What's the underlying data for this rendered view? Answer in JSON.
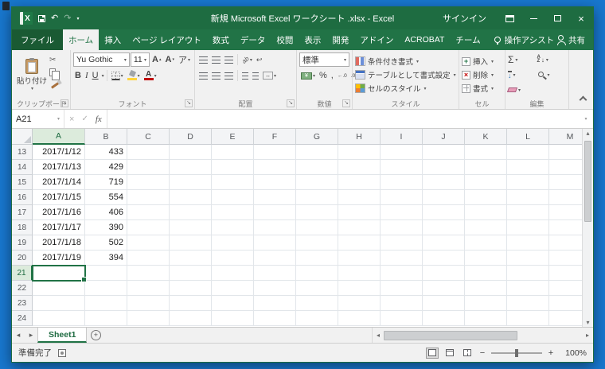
{
  "colors": {
    "accent": "#217346",
    "titlebar": "#1E6C41",
    "desktop": "#1877CE"
  },
  "titlebar": {
    "title": "新規 Microsoft Excel ワークシート .xlsx - Excel",
    "sign_in": "サインイン"
  },
  "ribbon": {
    "file_tab": "ファイル",
    "active_tab": "ホーム",
    "tabs": [
      "ホーム",
      "挿入",
      "ページ レイアウト",
      "数式",
      "データ",
      "校閲",
      "表示",
      "開発",
      "アドイン",
      "ACROBAT",
      "チーム"
    ],
    "tell_me": "操作アシスト",
    "share": "共有",
    "groups": {
      "clipboard": {
        "label": "クリップボード",
        "paste": "貼り付け"
      },
      "font": {
        "label": "フォント",
        "name": "Yu Gothic",
        "size": "11"
      },
      "alignment": {
        "label": "配置"
      },
      "number": {
        "label": "数値",
        "format": "標準"
      },
      "styles": {
        "label": "スタイル",
        "items": [
          "条件付き書式",
          "テーブルとして書式設定",
          "セルのスタイル"
        ]
      },
      "cells": {
        "label": "セル",
        "items": [
          "挿入",
          "削除",
          "書式"
        ]
      },
      "editing": {
        "label": "編集"
      }
    }
  },
  "formula_bar": {
    "name_box": "A21",
    "cancel": "×",
    "enter": "✓",
    "fx": "fx",
    "value": ""
  },
  "sheet": {
    "columns": [
      "A",
      "B",
      "C",
      "D",
      "E",
      "F",
      "G",
      "H",
      "I",
      "J",
      "K",
      "L",
      "M"
    ],
    "rows": [
      {
        "n": "13",
        "cells": {
          "A": "2017/1/12",
          "B": "433"
        }
      },
      {
        "n": "14",
        "cells": {
          "A": "2017/1/13",
          "B": "429"
        }
      },
      {
        "n": "15",
        "cells": {
          "A": "2017/1/14",
          "B": "719"
        }
      },
      {
        "n": "16",
        "cells": {
          "A": "2017/1/15",
          "B": "554"
        }
      },
      {
        "n": "17",
        "cells": {
          "A": "2017/1/16",
          "B": "406"
        }
      },
      {
        "n": "18",
        "cells": {
          "A": "2017/1/17",
          "B": "390"
        }
      },
      {
        "n": "19",
        "cells": {
          "A": "2017/1/18",
          "B": "502"
        }
      },
      {
        "n": "20",
        "cells": {
          "A": "2017/1/19",
          "B": "394"
        }
      },
      {
        "n": "21",
        "cells": {}
      },
      {
        "n": "22",
        "cells": {}
      },
      {
        "n": "23",
        "cells": {}
      },
      {
        "n": "24",
        "cells": {}
      }
    ],
    "selection": {
      "col": "A",
      "row": "21"
    },
    "sheet_tab": "Sheet1"
  },
  "status_bar": {
    "ready": "準備完了",
    "zoom": "100%"
  },
  "icons": {
    "app_x": "X",
    "caret": "▾",
    "caret_up": "▴",
    "tri_left": "◂",
    "tri_right": "▸",
    "tri_up": "▴",
    "tri_down": "▾",
    "close": "×",
    "minus": "−",
    "plus": "+",
    "undo": "↶",
    "redo": "↷",
    "cut": "✂",
    "sigma": "Σ",
    "percent": "%",
    "comma": ",",
    "yen": "¥",
    "dec_inc": "←.0",
    "dec_dec": ".00→",
    "arrow_down": "↓",
    "arrow_lr": "↔",
    "wrap": "↩",
    "orient": "ab",
    "bold": "B",
    "italic": "I",
    "underline": "U",
    "letterA": "A",
    "phonetic": "ア",
    "sort_a": "A",
    "sort_z": "Z",
    "launcher": "↘"
  }
}
